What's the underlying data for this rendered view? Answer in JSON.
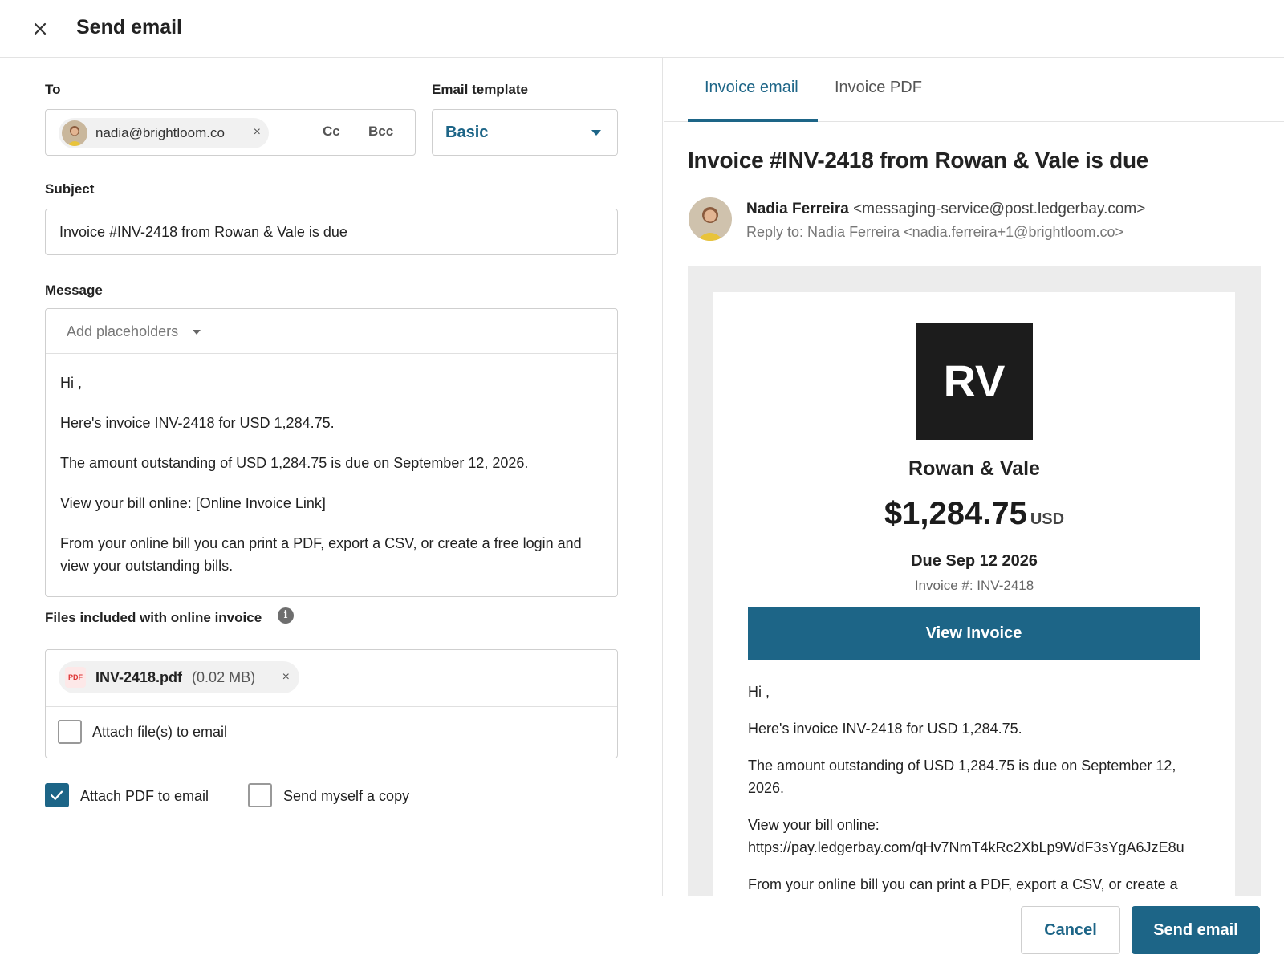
{
  "header": {
    "title": "Send email"
  },
  "form": {
    "to_label": "To",
    "recipient_email": "nadia@brightloom.co",
    "remove_symbol": "×",
    "cc_label": "Cc",
    "bcc_label": "Bcc",
    "template_label": "Email template",
    "template_value": "Basic",
    "subject_label": "Subject",
    "subject_value": "Invoice #INV-2418 from Rowan & Vale is due",
    "message_label": "Message",
    "add_placeholders_label": "Add placeholders",
    "message_lines": [
      "Hi ,",
      "Here's invoice INV-2418 for USD 1,284.75.",
      "The amount outstanding of USD 1,284.75 is due on September 12, 2026.",
      "View your bill online: [Online Invoice Link]",
      "From your online bill you can print a PDF, export a CSV, or create a free login and view your outstanding bills."
    ],
    "files_label": "Files included with online invoice",
    "info_symbol": "i",
    "file": {
      "badge": "PDF",
      "name": "INV-2418.pdf",
      "size": "(0.02 MB)",
      "remove_symbol": "×"
    },
    "attach_files_label": "Attach file(s) to email",
    "attach_files_checked": false,
    "attach_pdf_label": "Attach PDF to email",
    "attach_pdf_checked": true,
    "send_copy_label": "Send myself a copy",
    "send_copy_checked": false
  },
  "preview": {
    "tabs": [
      {
        "label": "Invoice email",
        "active": true
      },
      {
        "label": "Invoice PDF",
        "active": false
      }
    ],
    "title": "Invoice #INV-2418 from Rowan & Vale is due",
    "sender_name": "Nadia Ferreira",
    "sender_address": "<messaging-service@post.ledgerbay.com>",
    "reply_to": "Reply to: Nadia Ferreira <nadia.ferreira+1@brightloom.co>",
    "logo_text": "RV",
    "company": "Rowan & Vale",
    "amount": "$1,284.75",
    "currency": "USD",
    "due": "Due Sep 12 2026",
    "invoice_number": "Invoice #: INV-2418",
    "view_button": "View Invoice",
    "body": {
      "greeting": "Hi ,",
      "line1": "Here's invoice INV-2418 for USD 1,284.75.",
      "line2": "The amount outstanding of USD 1,284.75 is due on September 12, 2026.",
      "line3_label": "View your bill online:",
      "line3_url": "https://pay.ledgerbay.com/qHv7NmT4kRc2XbLp9WdF3sYgA6JzE8u",
      "line4": "From your online bill you can print a PDF, export a CSV, or create a free login and view your outstanding bills."
    }
  },
  "footer": {
    "cancel_label": "Cancel",
    "send_label": "Send email"
  },
  "colors": {
    "accent": "#1d6587",
    "logo_bg": "#1c1c1c",
    "preview_bg": "#ececec"
  }
}
